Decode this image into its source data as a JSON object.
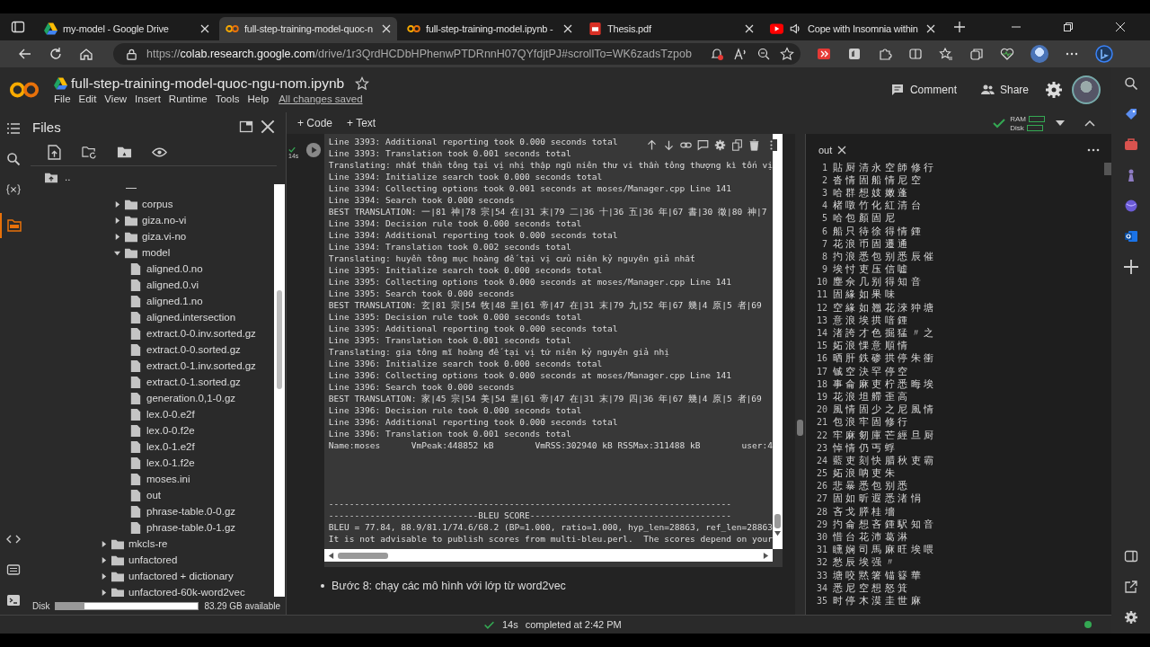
{
  "browser": {
    "tabs": [
      {
        "title": "my-model - Google Drive",
        "kind": "drive",
        "selected": false
      },
      {
        "title": "full-step-training-model-quoc-n",
        "kind": "colab",
        "selected": true
      },
      {
        "title": "full-step-training-model.ipynb -",
        "kind": "colab",
        "selected": false
      },
      {
        "title": "Thesis.pdf",
        "kind": "pdf",
        "selected": false
      },
      {
        "title": "Cope with Insomnia within",
        "kind": "video",
        "selected": false
      }
    ],
    "url_scheme": "https://",
    "url_host": "colab.research.google.com",
    "url_path": "/drive/1r3QrdHCDbHPhenwPTDRnnH07QYfdjtPJ#scrollTo=WK6zadsTzpob"
  },
  "notebook": {
    "title": "full-step-training-model-quoc-ngu-nom.ipynb",
    "starred": false,
    "menu": [
      "File",
      "Edit",
      "View",
      "Insert",
      "Runtime",
      "Tools",
      "Help"
    ],
    "save_status": "All changes saved",
    "actions": [
      "Comment",
      "Share"
    ],
    "toolbar": {
      "add_code": "+ Code",
      "add_text": "+ Text",
      "ram": "RAM",
      "disk": "Disk"
    }
  },
  "files": {
    "title": "Files",
    "parent": "..",
    "tree": [
      {
        "kind": "group",
        "children": [
          {
            "kind": "folder",
            "name": "corpus",
            "expanded": false
          },
          {
            "kind": "folder",
            "name": "giza.no-vi",
            "expanded": false
          },
          {
            "kind": "folder",
            "name": "giza.vi-no",
            "expanded": false
          },
          {
            "kind": "folder",
            "name": "model",
            "expanded": true,
            "children": [
              {
                "kind": "file",
                "name": "aligned.0.no"
              },
              {
                "kind": "file",
                "name": "aligned.0.vi"
              },
              {
                "kind": "file",
                "name": "aligned.1.no"
              },
              {
                "kind": "file",
                "name": "aligned.intersection"
              },
              {
                "kind": "file",
                "name": "extract.0-0.inv.sorted.gz"
              },
              {
                "kind": "file",
                "name": "extract.0-0.sorted.gz"
              },
              {
                "kind": "file",
                "name": "extract.0-1.inv.sorted.gz"
              },
              {
                "kind": "file",
                "name": "extract.0-1.sorted.gz"
              },
              {
                "kind": "file",
                "name": "generation.0,1-0.gz"
              },
              {
                "kind": "file",
                "name": "lex.0-0.e2f"
              },
              {
                "kind": "file",
                "name": "lex.0-0.f2e"
              },
              {
                "kind": "file",
                "name": "lex.0-1.e2f"
              },
              {
                "kind": "file",
                "name": "lex.0-1.f2e"
              },
              {
                "kind": "file",
                "name": "moses.ini"
              },
              {
                "kind": "file",
                "name": "out"
              },
              {
                "kind": "file",
                "name": "phrase-table.0-0.gz"
              },
              {
                "kind": "file",
                "name": "phrase-table.0-1.gz"
              }
            ]
          }
        ]
      },
      {
        "kind": "folder",
        "name": "mkcls-re",
        "expanded": false
      },
      {
        "kind": "folder",
        "name": "unfactored",
        "expanded": false
      },
      {
        "kind": "folder",
        "name": "unfactored + dictionary",
        "expanded": false
      },
      {
        "kind": "folder",
        "name": "unfactored-60k-word2vec",
        "expanded": false
      }
    ],
    "disk": {
      "label": "Disk",
      "level": 0.2,
      "available": "83.29 GB available"
    }
  },
  "cell": {
    "exec_time": "14s",
    "log_lines": [
      "Line 3393: Additional reporting took 0.000 seconds total",
      "Line 3393: Translation took 0.001 seconds total",
      "Translating: nhất thần tông tại vị nhị thập ngũ niên thư vi thần tông thượng kì tốn vị",
      "Line 3394: Initialize search took 0.000 seconds total",
      "Line 3394: Collecting options took 0.001 seconds at moses/Manager.cpp Line 141",
      "Line 3394: Search took 0.000 seconds",
      "BEST TRANSLATION: 一|81 神|78 宗|54 在|31 末|79 二|36 十|36 五|36 年|67 書|30 徵|80 神|7",
      "Line 3394: Decision rule took 0.000 seconds total",
      "Line 3394: Additional reporting took 0.000 seconds total",
      "Line 3394: Translation took 0.002 seconds total",
      "Translating: huyền tông mục hoàng đế tại vị cửu niên kỷ nguyên giả nhất",
      "Line 3395: Initialize search took 0.000 seconds total",
      "Line 3395: Collecting options took 0.000 seconds at moses/Manager.cpp Line 141",
      "Line 3395: Search took 0.000 seconds",
      "BEST TRANSLATION: 玄|81 宗|54 牧|48 皇|61 帝|47 在|31 末|79 九|52 年|67 幾|4 原|5 者|69",
      "Line 3395: Decision rule took 0.000 seconds total",
      "Line 3395: Additional reporting took 0.000 seconds total",
      "Line 3395: Translation took 0.001 seconds total",
      "Translating: gia tông mĩ hoàng đế tại vị tứ niên kỷ nguyên giả nhị",
      "Line 3396: Initialize search took 0.000 seconds total",
      "Line 3396: Collecting options took 0.000 seconds at moses/Manager.cpp Line 141",
      "Line 3396: Search took 0.000 seconds",
      "BEST TRANSLATION: 家|45 宗|54 美|54 皇|61 帝|47 在|31 末|79 四|36 年|67 幾|4 原|5 者|69",
      "Line 3396: Decision rule took 0.000 seconds total",
      "Line 3396: Additional reporting took 0.000 seconds total",
      "Line 3396: Translation took 0.001 seconds total",
      "Name:moses      VmPeak:448852 kB        VmRSS:302940 kB RSSMax:311488 kB        user:4"
    ],
    "score_lines": [
      "------------------------------------------------------------------------------",
      "-----------------------------BLEU SCORE---------------------------------------",
      "BLEU = 77.84, 88.9/81.1/74.6/68.2 (BP=1.000, ratio=1.000, hyp_len=28863, ref_len=28863",
      "It is not advisable to publish scores from multi-bleu.perl.  The scores depend on your"
    ]
  },
  "markdown": {
    "bullet": "Bước 8: chạy các mô hình với lớp từ word2vec"
  },
  "viewer": {
    "tab": "out",
    "lines": [
      {
        "n": "1",
        "text": "貼 厨 清 永 空 師 修 行"
      },
      {
        "n": "2",
        "text": "沓 情 固 船 情 尼 空"
      },
      {
        "n": "3",
        "text": "哈 群 想 妓 嫩 蓬"
      },
      {
        "n": "4",
        "text": "楮 噋 竹 化 紅 清 台"
      },
      {
        "n": "5",
        "text": "哈 包 顏 固 尼"
      },
      {
        "n": "6",
        "text": "船 只 待 徐 得 情 鍾"
      },
      {
        "n": "7",
        "text": "花 浪 币 固 遷 通"
      },
      {
        "n": "8",
        "text": "扚 浪 悉 包 别 悉 辰 催"
      },
      {
        "n": "9",
        "text": "埃 忖 吏 压 信 嘘"
      },
      {
        "n": "10",
        "text": "塵 佘 几 别 得 知 音"
      },
      {
        "n": "11",
        "text": "固 緣 如 果 味"
      },
      {
        "n": "12",
        "text": "空 緣 如 翘 花 淶 狆 塘"
      },
      {
        "n": "13",
        "text": "意 浪 埃 拱 喑 鍾"
      },
      {
        "n": "14",
        "text": "渚 誇 才 色 掘 猛 〃 之"
      },
      {
        "n": "15",
        "text": "妬 浪 惈 意 順 情"
      },
      {
        "n": "16",
        "text": "晒 肝 鉄 碜 拱 停 朱 衝"
      },
      {
        "n": "17",
        "text": "铖 空 決 罕 停 空"
      },
      {
        "n": "18",
        "text": "事 侖 麻 吏 柠 悉 晦 埃"
      },
      {
        "n": "19",
        "text": "花 浪 坦 艜 歪 高"
      },
      {
        "n": "20",
        "text": "風 情 固 少 之 尼 風 情"
      },
      {
        "n": "21",
        "text": "包 浪 牢 固 修 行"
      },
      {
        "n": "22",
        "text": "牢 麻 剱 庫 芒 經 旦 厨"
      },
      {
        "n": "23",
        "text": "悼 情 仍 丐 蜉"
      },
      {
        "n": "24",
        "text": "藍 吏 刻 快 腊 秋 吏 霸"
      },
      {
        "n": "25",
        "text": "妬 浪 呐 吏 朱"
      },
      {
        "n": "26",
        "text": "悲 暴 悉 包 别 悉"
      },
      {
        "n": "27",
        "text": "固 如 昕 遐 悉 渚 悁"
      },
      {
        "n": "28",
        "text": "吝 戈 膵 桂 墻"
      },
      {
        "n": "29",
        "text": "扚 侖 想 吝 鍾 駅 知 音"
      },
      {
        "n": "30",
        "text": "惜 台 花 沛 葛 淋"
      },
      {
        "n": "31",
        "text": "矄 娴 司 馬 麻 旺 埃 喂"
      },
      {
        "n": "32",
        "text": "愁 辰 埃 强 〃"
      },
      {
        "n": "33",
        "text": "塘 咬 黙 箸 锚 簮 華"
      },
      {
        "n": "34",
        "text": "悉 尼 空 想 怒 箕"
      },
      {
        "n": "35",
        "text": "时 停 木 漠 圭 世 麻"
      }
    ]
  },
  "status": {
    "elapsed": "14s",
    "message": "completed at 2:42 PM",
    "connected": true
  }
}
